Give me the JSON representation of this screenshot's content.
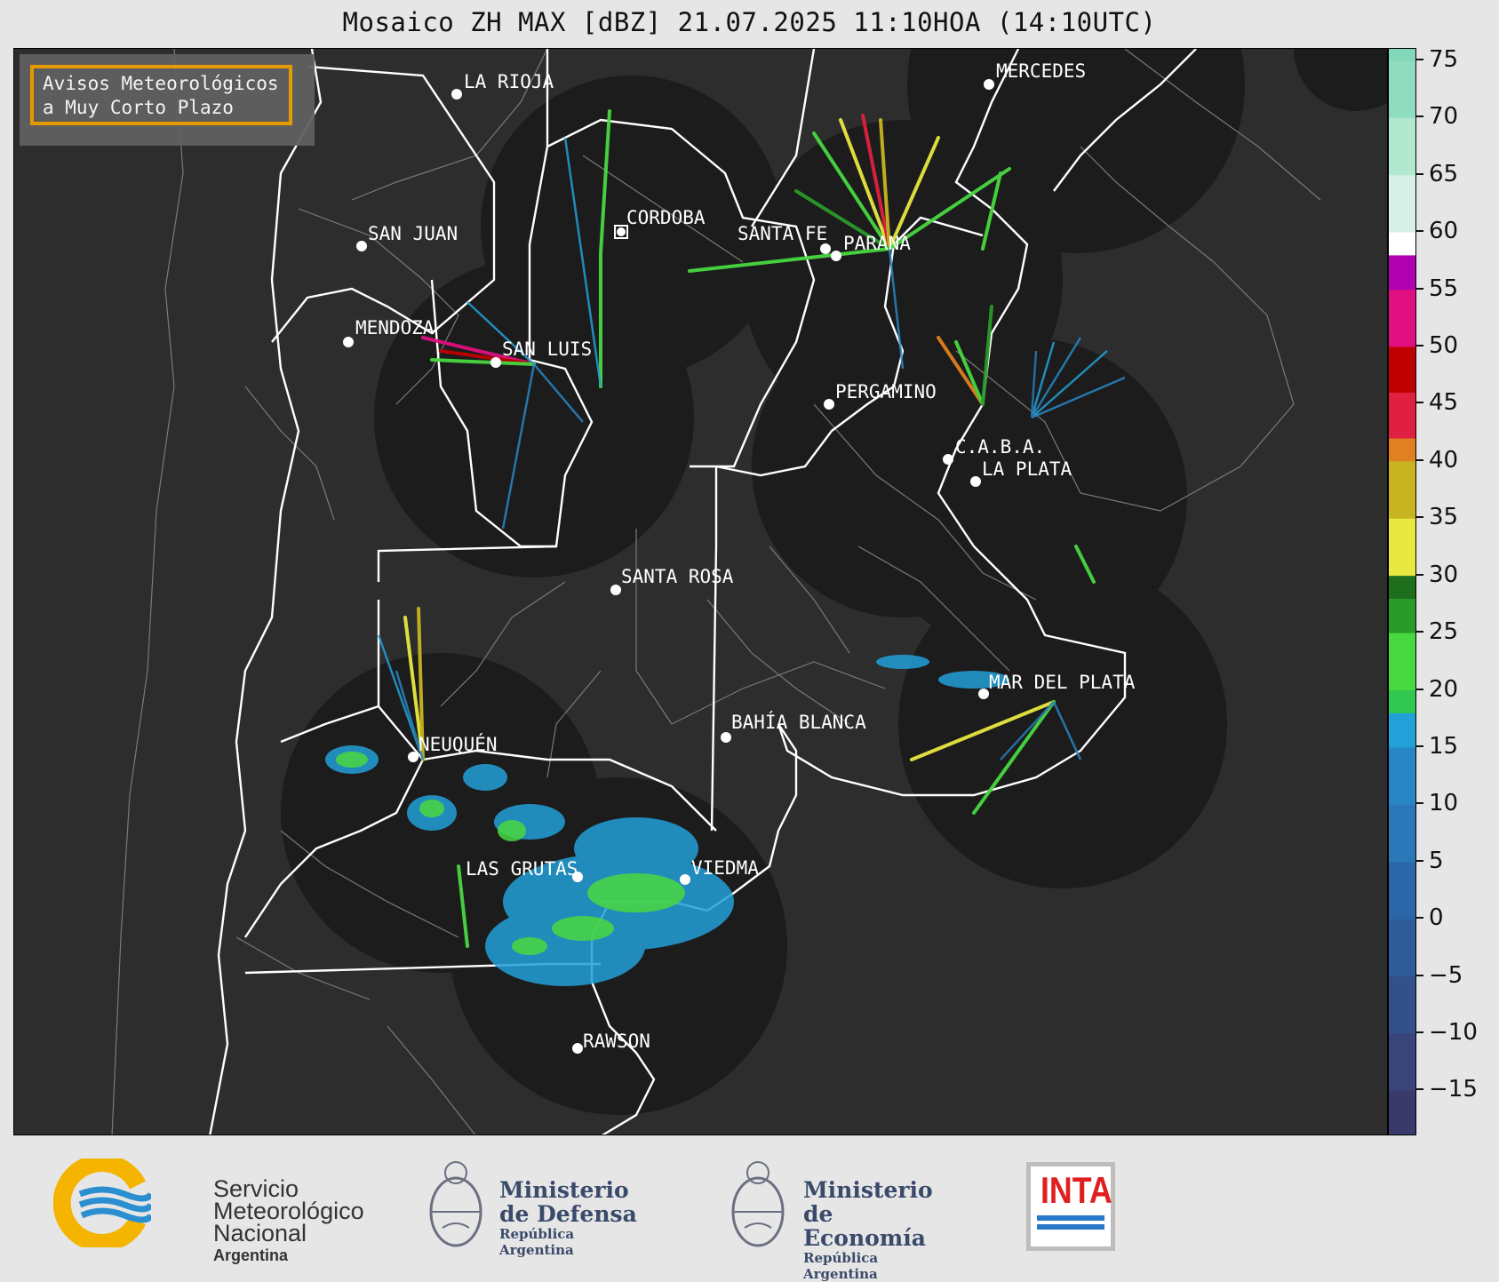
{
  "title": "Mosaico ZH MAX [dBZ] 21.07.2025 11:10HOA (14:10UTC)",
  "avisos": {
    "line1": "Avisos Meteorológicos",
    "line2": "a Muy Corto Plazo"
  },
  "cities": [
    {
      "name": "LA RIOJA"
    },
    {
      "name": "MERCEDES"
    },
    {
      "name": "CORDOBA"
    },
    {
      "name": "SAN JUAN"
    },
    {
      "name": "SANTA FE"
    },
    {
      "name": "PARANA"
    },
    {
      "name": "MENDOZA"
    },
    {
      "name": "SAN LUIS"
    },
    {
      "name": "PERGAMINO"
    },
    {
      "name": "C.A.B.A."
    },
    {
      "name": "LA PLATA"
    },
    {
      "name": "SANTA ROSA"
    },
    {
      "name": "MAR DEL PLATA"
    },
    {
      "name": "BAHÍA BLANCA"
    },
    {
      "name": "NEUQUÉN"
    },
    {
      "name": "LAS GRUTAS"
    },
    {
      "name": "VIEDMA"
    },
    {
      "name": "RAWSON"
    }
  ],
  "colorbar": {
    "unit": "dBZ",
    "min": -19,
    "max": 76,
    "ticks": [
      "75",
      "70",
      "65",
      "60",
      "55",
      "50",
      "45",
      "40",
      "35",
      "30",
      "25",
      "20",
      "15",
      "10",
      "5",
      "0",
      "−5",
      "−10",
      "−15"
    ],
    "tick_values": [
      75,
      70,
      65,
      60,
      55,
      50,
      45,
      40,
      35,
      30,
      25,
      20,
      15,
      10,
      5,
      0,
      -5,
      -10,
      -15
    ],
    "colors": {
      "-20": "#3a3a6a",
      "-15": "#3a4478",
      "-10": "#34508a",
      "-5": "#2f5c98",
      "0": "#2a66a8",
      "5": "#2a78b8",
      "10": "#2886c4",
      "15": "#22a0d8",
      "18": "#30c850",
      "20": "#48d840",
      "25": "#2a9a2a",
      "28": "#1e6e1e",
      "30": "#e8e840",
      "35": "#c8b420",
      "40": "#e08020",
      "42": "#e02040",
      "46": "#c00000",
      "50": "#e01080",
      "55": "#b000b0",
      "58": "#ffffff",
      "60": "#d8f0e8",
      "65": "#b0e8d0",
      "70": "#90dcc0",
      "75": "#80d8b8"
    }
  },
  "footer": {
    "smn": {
      "line1": "Servicio",
      "line2": "Meteorológico",
      "line3": "Nacional",
      "line4": "Argentina"
    },
    "defensa": {
      "line1": "Ministerio",
      "line2": "de Defensa",
      "line3": "República Argentina"
    },
    "economia": {
      "line1": "Ministerio",
      "line2": "de Economía",
      "line3": "República Argentina"
    },
    "inta": {
      "label": "INTA"
    }
  }
}
